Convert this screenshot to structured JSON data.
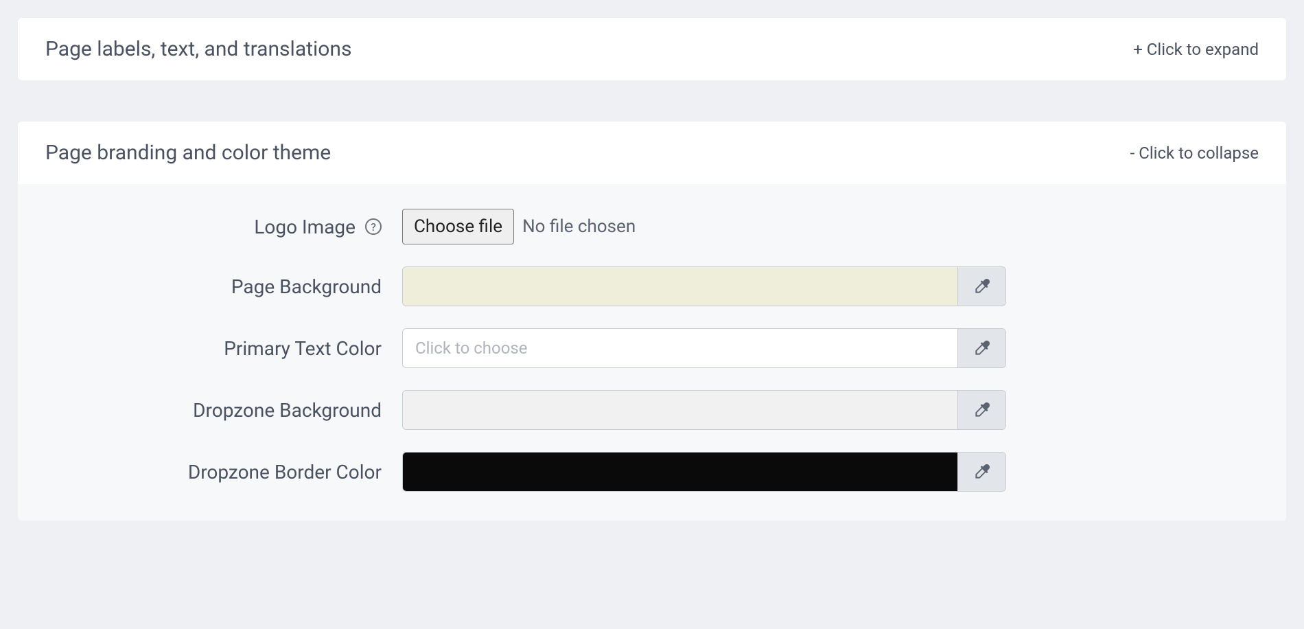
{
  "panels": {
    "labels": {
      "title": "Page labels, text, and translations",
      "toggle": "+ Click to expand"
    },
    "branding": {
      "title": "Page branding and color theme",
      "toggle": "- Click to collapse",
      "fields": {
        "logo": {
          "label": "Logo Image",
          "button": "Choose file",
          "status": "No file chosen"
        },
        "pageBackground": {
          "label": "Page Background",
          "color": "#efeedb"
        },
        "primaryTextColor": {
          "label": "Primary Text Color",
          "placeholder": "Click to choose",
          "color": "#ffffff"
        },
        "dropzoneBackground": {
          "label": "Dropzone Background",
          "color": "#f1f1f1"
        },
        "dropzoneBorderColor": {
          "label": "Dropzone Border Color",
          "color": "#0a0a0a"
        }
      }
    }
  }
}
